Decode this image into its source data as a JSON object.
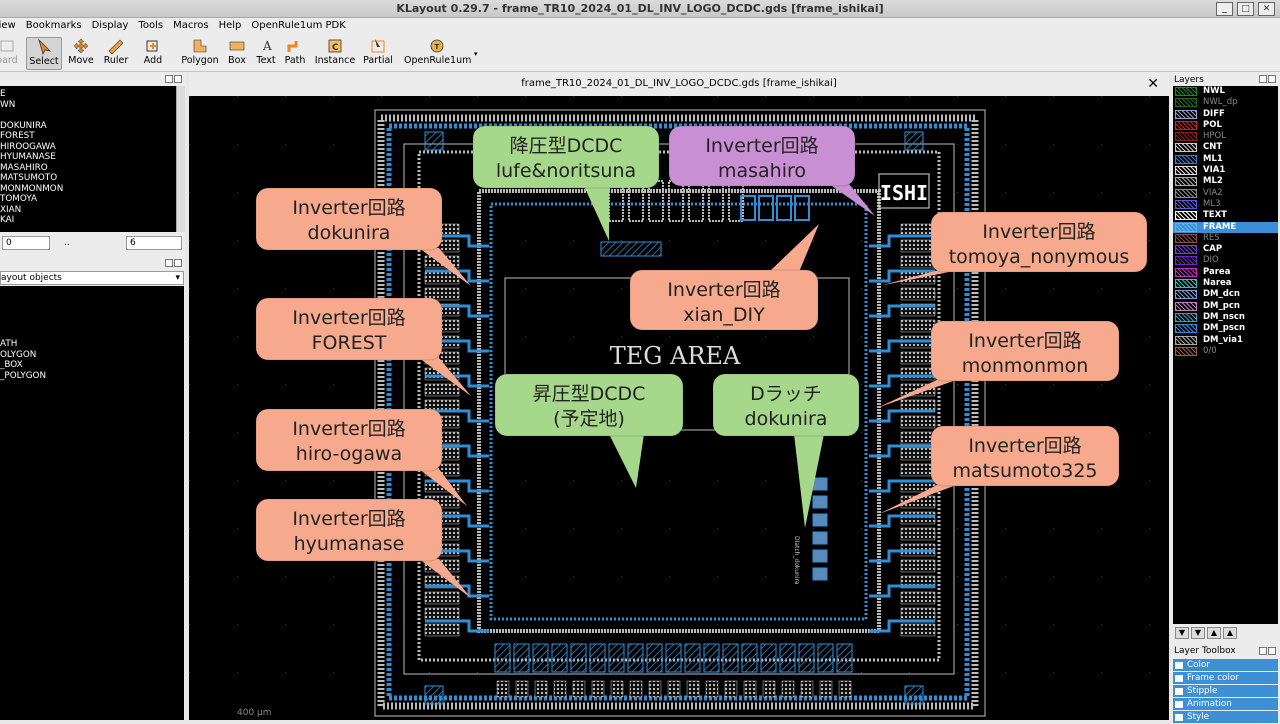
{
  "window": {
    "title": "KLayout 0.29.7 - frame_TR10_2024_01_DL_INV_LOGO_DCDC.gds [frame_ishikai]"
  },
  "menu": [
    "View",
    "Bookmarks",
    "Display",
    "Tools",
    "Macros",
    "Help",
    "OpenRule1um PDK"
  ],
  "toolbar": {
    "board": "oard",
    "tools": [
      "Select",
      "Move",
      "Ruler",
      "Add",
      "Polygon",
      "Box",
      "Text",
      "Path",
      "Instance",
      "Partial",
      "OpenRule1um"
    ]
  },
  "cells": [
    "E",
    "WN",
    "",
    "DOKUNIRA",
    "FOREST",
    "HIROOGAWA",
    "HYUMANASE",
    "MASAHIRO",
    "MATSUMOTO",
    "MONMONMON",
    "TOMOYA",
    "XIAN",
    "KAI"
  ],
  "hier": {
    "from": "0",
    "to": "6",
    "dots": ".."
  },
  "objects": {
    "combo": "ayout objects",
    "items": [
      "ATH",
      "OLYGON",
      "_BOX",
      "_POLYGON"
    ]
  },
  "document": {
    "tab": "frame_TR10_2024_01_DL_INV_LOGO_DCDC.gds [frame_ishikai]"
  },
  "layout": {
    "area_label": "TEG  AREA",
    "logo": "ISHI",
    "scale": "400 µm",
    "dlatch_text": "Dlatch_dokunira"
  },
  "callouts": [
    {
      "l1": "降圧型DCDC",
      "l2": "lufe&noritsuna",
      "color": "#a6d88b"
    },
    {
      "l1": "Inverter回路",
      "l2": "masahiro",
      "color": "#c88fd2"
    },
    {
      "l1": "Inverter回路",
      "l2": "dokunira",
      "color": "#f6a98d"
    },
    {
      "l1": "Inverter回路",
      "l2": "tomoya_nonymous",
      "color": "#f6a98d"
    },
    {
      "l1": "Inverter回路",
      "l2": "xian_DIY",
      "color": "#f6a98d"
    },
    {
      "l1": "Inverter回路",
      "l2": "FOREST",
      "color": "#f6a98d"
    },
    {
      "l1": "Inverter回路",
      "l2": "monmonmon",
      "color": "#f6a98d"
    },
    {
      "l1": "昇圧型DCDC",
      "l2": "(予定地)",
      "color": "#a6d88b"
    },
    {
      "l1": "Dラッチ",
      "l2": "dokunira",
      "color": "#a6d88b"
    },
    {
      "l1": "Inverter回路",
      "l2": "hiro-ogawa",
      "color": "#f6a98d"
    },
    {
      "l1": "Inverter回路",
      "l2": "matsumoto325",
      "color": "#f6a98d"
    },
    {
      "l1": "Inverter回路",
      "l2": "hyumanase",
      "color": "#f6a98d"
    }
  ],
  "layers_title": "Layers",
  "layers": [
    {
      "name": "NWL",
      "color": "#1a8a1a",
      "dim": false
    },
    {
      "name": "NWL_dp",
      "color": "#1a6a1a",
      "dim": true
    },
    {
      "name": "DIFF",
      "color": "#9a9acd",
      "dim": false
    },
    {
      "name": "POL",
      "color": "#d42020",
      "dim": false
    },
    {
      "name": "HPOL",
      "color": "#8a2020",
      "dim": true
    },
    {
      "name": "CNT",
      "color": "#cccccc",
      "dim": false
    },
    {
      "name": "ML1",
      "color": "#3a7ad6",
      "dim": false
    },
    {
      "name": "VIA1",
      "color": "#dddddd",
      "dim": false
    },
    {
      "name": "ML2",
      "color": "#aaaaaa",
      "dim": false
    },
    {
      "name": "VIA2",
      "color": "#888888",
      "dim": true
    },
    {
      "name": "ML3",
      "color": "#5a5ad6",
      "dim": true
    },
    {
      "name": "TEXT",
      "color": "#ffffff",
      "dim": false
    },
    {
      "name": "FRAME",
      "color": "#5ab4e6",
      "dim": false
    },
    {
      "name": "RES",
      "color": "#8a4a4a",
      "dim": true
    },
    {
      "name": "CAP",
      "color": "#7a3ad6",
      "dim": false
    },
    {
      "name": "DIO",
      "color": "#6a2ac0",
      "dim": true
    },
    {
      "name": "Parea",
      "color": "#c030c0",
      "dim": false
    },
    {
      "name": "Narea",
      "color": "#30c0c0",
      "dim": false
    },
    {
      "name": "DM_dcn",
      "color": "#7a9ad6",
      "dim": false
    },
    {
      "name": "DM_pcn",
      "color": "#c080c0",
      "dim": false
    },
    {
      "name": "DM_nscn",
      "color": "#30a0c0",
      "dim": false
    },
    {
      "name": "DM_pscn",
      "color": "#3a8ad6",
      "dim": false
    },
    {
      "name": "DM_via1",
      "color": "#aaaaaa",
      "dim": false
    },
    {
      "name": "0/0",
      "color": "#a05a3a",
      "dim": true
    }
  ],
  "toolbox": {
    "title": "Layer Toolbox",
    "items": [
      "Color",
      "Frame color",
      "Stipple",
      "Animation",
      "Style"
    ]
  },
  "colors": {
    "ml1": "#2f8fd6",
    "ml2": "#bdbdbd",
    "canvas": "#000000",
    "selection": "#3a8fd6"
  }
}
